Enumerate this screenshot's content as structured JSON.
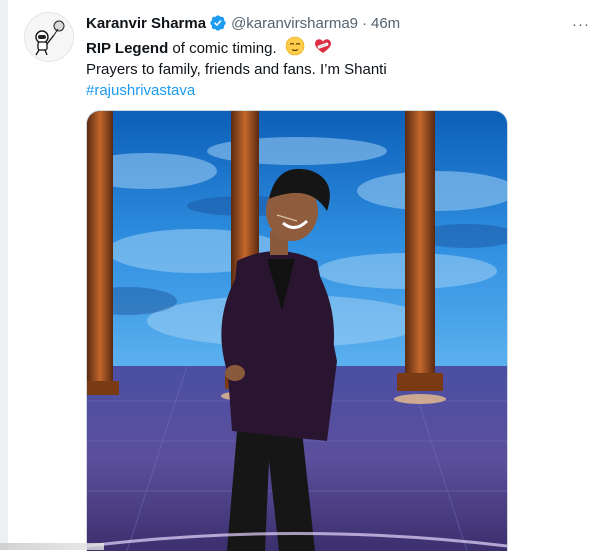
{
  "tweet": {
    "author_name": "Karanvir Sharma",
    "handle": "@karanvirsharma9",
    "separator": "·",
    "time": "46m",
    "more_glyph": "···",
    "line1_bold": "RIP Legend",
    "line1_rest": " of comic timing.",
    "line2": "Prayers to family, friends and fans. I’m Shanti",
    "hashtag": "#rajushrivastava",
    "emojis": [
      "relieved-face-emoji",
      "mending-heart-emoji"
    ],
    "colors": {
      "verified": "#1d9bf0",
      "hashtag": "#1d9bf0",
      "secondary_text": "#536471"
    }
  },
  "media": {
    "description_icon": "photo-of-man-in-velvet-blazer-on-stage"
  }
}
